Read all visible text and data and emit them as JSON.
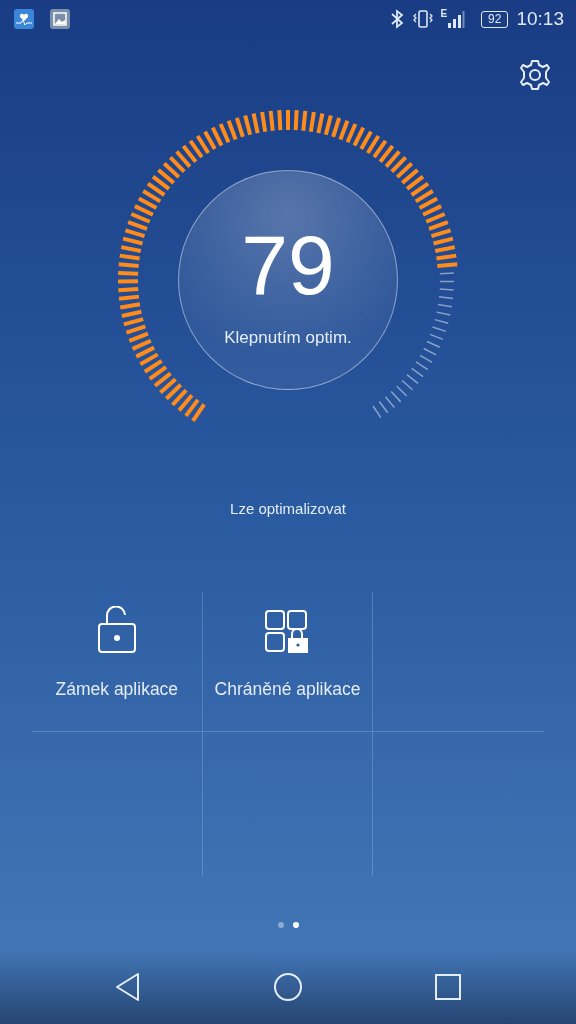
{
  "status_bar": {
    "network": "E",
    "battery": "92",
    "time": "10:13"
  },
  "gauge": {
    "score": "79",
    "action": "Klepnutím optim."
  },
  "status_text": "Lze optimalizovat",
  "tiles": [
    {
      "kind": "lock",
      "label": "Zámek aplikace"
    },
    {
      "kind": "protected",
      "label": "Chráněné aplikace"
    }
  ],
  "pager": [
    {
      "selected": false
    },
    {
      "selected": true
    }
  ]
}
